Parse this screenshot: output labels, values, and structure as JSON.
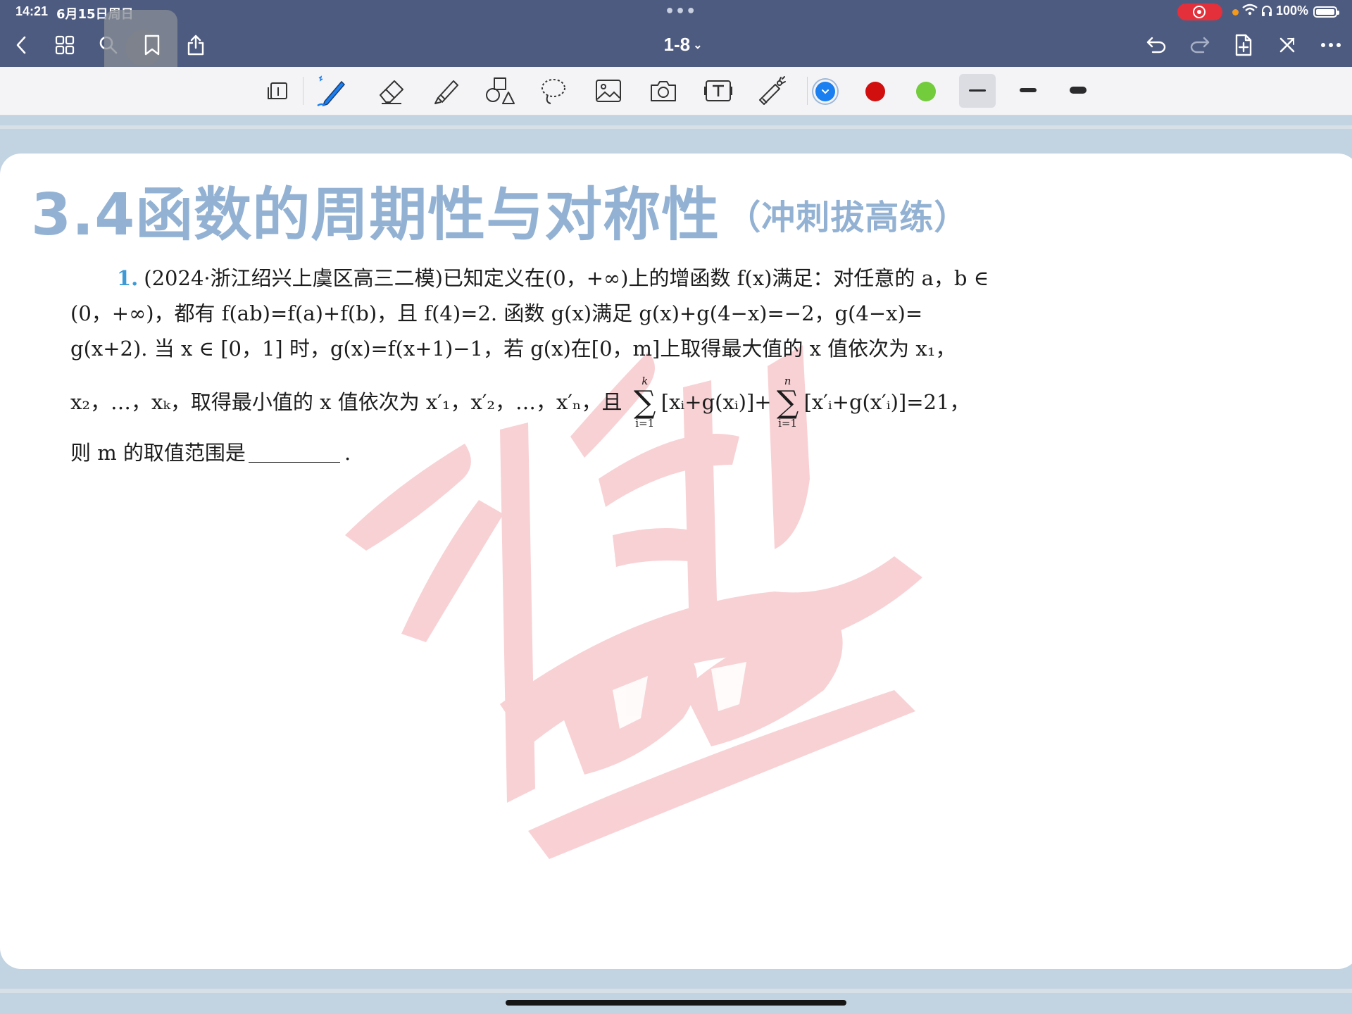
{
  "status_bar": {
    "time": "14:21",
    "date": "6月15日周日",
    "battery": "100%"
  },
  "nav": {
    "doc_title": "1-8",
    "icons": [
      "back-icon",
      "grid-icon",
      "search-icon",
      "bookmark-icon",
      "share-icon",
      "undo-icon",
      "redo-icon",
      "add-page-icon",
      "close-icon",
      "more-icon"
    ]
  },
  "toolbar": {
    "tools": [
      "reader-mode-icon",
      "pen-icon",
      "eraser-icon",
      "highlighter-icon",
      "shapes-icon",
      "lasso-icon",
      "image-icon",
      "camera-icon",
      "text-box-icon",
      "laser-pointer-icon"
    ],
    "colors": [
      "#1a7ff0",
      "#d10f0f",
      "#73cc3c"
    ],
    "selected_color": "#1a7ff0",
    "thickness_levels": 3,
    "selected_thickness": 1
  },
  "document": {
    "title_main": "3.4函数的周期性与对称性",
    "title_sub": "（冲刺拔高练）",
    "problem": {
      "number": "1.",
      "line1": "(2024·浙江绍兴上虞区高三二模)已知定义在(0，+∞)上的增函数 f(x)满足：对任意的 a，b ∈",
      "line2": "(0，+∞)，都有 f(ab)=f(a)+f(b)，且 f(4)=2. 函数 g(x)满足 g(x)+g(4−x)=−2，g(4−x)=",
      "line3": "g(x+2). 当 x ∈ [0，1] 时，g(x)=f(x+1)−1，若 g(x)在[0，m]上取得最大值的 x 值依次为 x₁，",
      "line4_a": "x₂，…，xₖ，取得最小值的 x 值依次为 x′₁，x′₂，…，x′ₙ，且",
      "sum1_upper": "k",
      "sum_symbol": "∑",
      "sum1_lower": "i=1",
      "sum1_body": "[xᵢ+g(xᵢ)]+",
      "sum2_upper": "n",
      "sum2_lower": "i=1",
      "sum2_body": "[x′ᵢ+g(x′ᵢ)]=21，",
      "line5_a": "则 m 的取值范围是",
      "line5_b": "."
    }
  }
}
